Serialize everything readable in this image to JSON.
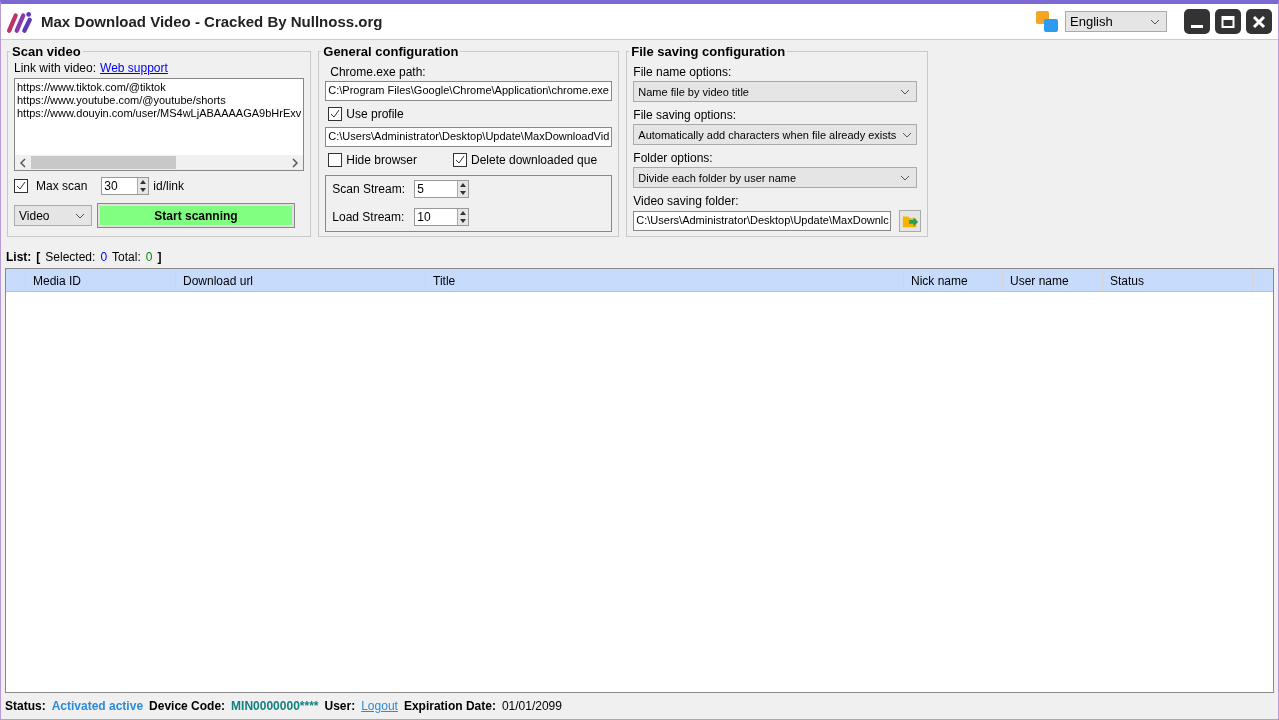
{
  "window": {
    "title": "Max Download Video - Cracked By Nullnoss.org",
    "language": "English"
  },
  "scan_video": {
    "title": "Scan video",
    "link_label": "Link with video:",
    "link": "Web support",
    "urls": [
      "https://www.tiktok.com/@tiktok",
      "https://www.youtube.com/@youtube/shorts",
      "https://www.douyin.com/user/MS4wLjABAAAAGA9bHrExv"
    ],
    "max_scan": {
      "label": "Max scan",
      "checked": true,
      "value": "30",
      "unit": "id/link"
    },
    "media_type": "Video",
    "start_button": "Start scanning"
  },
  "general": {
    "title": "General configuration",
    "chrome_label": "Chrome.exe path:",
    "chrome_path": "C:\\Program Files\\Google\\Chrome\\Application\\chrome.exe",
    "options": [
      {
        "label": "Use profile",
        "checked": true
      }
    ],
    "profile_path": "C:\\Users\\Administrator\\Desktop\\Update\\MaxDownloadVid",
    "toggles": [
      {
        "label": "Hide browser",
        "checked": false
      },
      {
        "label": "Delete downloaded que",
        "checked": true
      }
    ],
    "streams": [
      {
        "label": "Scan Stream:",
        "value": "5"
      },
      {
        "label": "Load Stream:",
        "value": "10"
      }
    ]
  },
  "file_saving": {
    "title": "File saving configuration",
    "selects": [
      {
        "label": "File name options:",
        "value": "Name file by video title"
      },
      {
        "label": "File saving options:",
        "value": "Automatically add characters when file already exists"
      },
      {
        "label": "Folder options:",
        "value": "Divide each folder by user name"
      }
    ],
    "folder_label": "Video saving folder:",
    "folder": "C:\\Users\\Administrator\\Desktop\\Update\\MaxDownlc"
  },
  "list": {
    "label": "List:",
    "open": "[",
    "selected_label": "Selected:",
    "selected": "0",
    "total_label": "Total:",
    "total": "0",
    "close": "]"
  },
  "table": {
    "columns": [
      "Media ID",
      "Download url",
      "Title",
      "Nick name",
      "User name",
      "Status"
    ]
  },
  "status_bar": {
    "status_label": "Status:",
    "status": "Activated active",
    "device_label": "Device Code:",
    "device": "MIN0000000****",
    "user_label": "User:",
    "logout": "Logout",
    "expiration_label": "Expiration Date:",
    "expiration": "01/01/2099"
  }
}
